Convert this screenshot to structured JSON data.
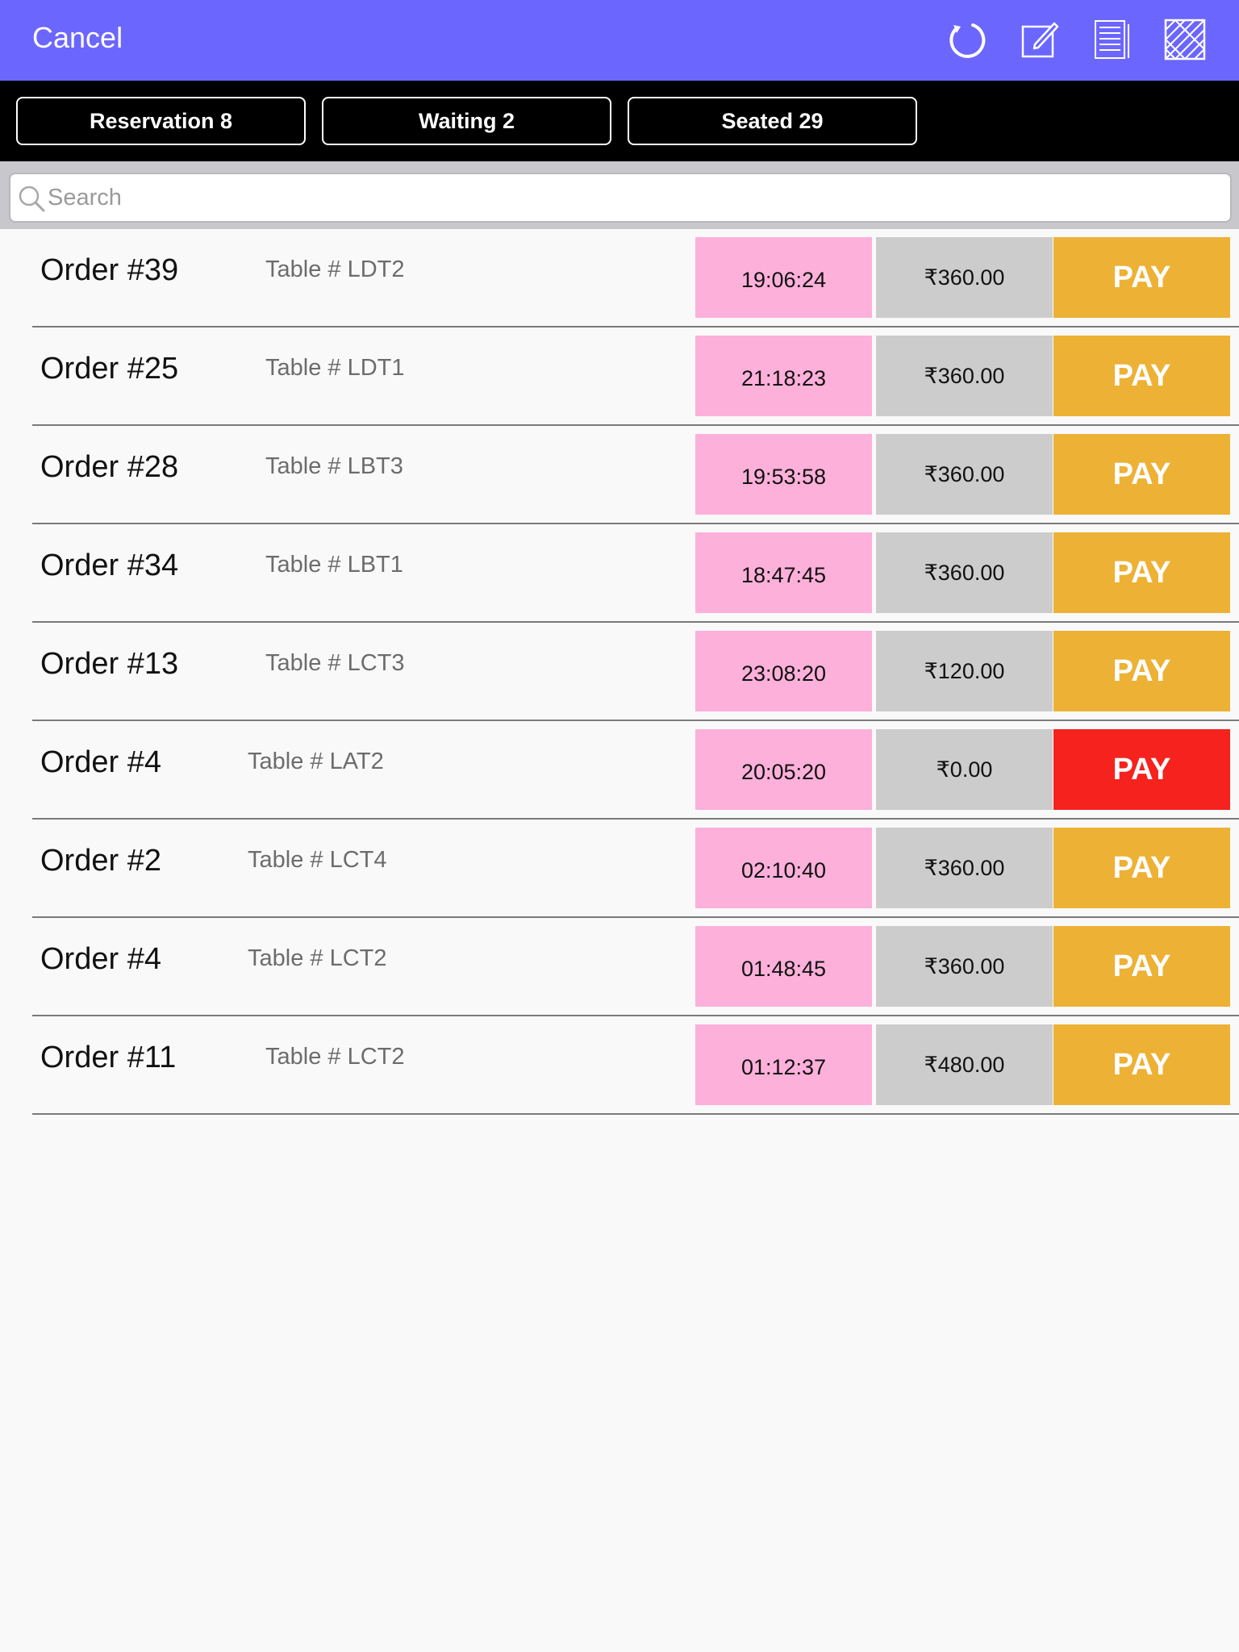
{
  "header": {
    "cancel_label": "Cancel",
    "background_color": "#6b66fd",
    "icons": [
      "refresh-icon",
      "edit-icon",
      "report-icon",
      "grid-pattern-icon"
    ]
  },
  "filters": [
    {
      "label": "Reservation 8"
    },
    {
      "label": "Waiting 2"
    },
    {
      "label": "Seated 29"
    }
  ],
  "search": {
    "placeholder": "Search",
    "value": ""
  },
  "colors": {
    "time_cell": "#fdb0da",
    "amount_cell": "#cccccc",
    "pay_default": "#edb135",
    "pay_alert": "#f6221e"
  },
  "orders": [
    {
      "order": "Order #39",
      "table": "Table # LDT2",
      "time": "19:06:24",
      "amount": "₹360.00",
      "pay_label": "PAY",
      "pay_color": "#edb135"
    },
    {
      "order": "Order #25",
      "table": "Table # LDT1",
      "time": "21:18:23",
      "amount": "₹360.00",
      "pay_label": "PAY",
      "pay_color": "#edb135"
    },
    {
      "order": "Order #28",
      "table": "Table # LBT3",
      "time": "19:53:58",
      "amount": "₹360.00",
      "pay_label": "PAY",
      "pay_color": "#edb135"
    },
    {
      "order": "Order #34",
      "table": "Table # LBT1",
      "time": "18:47:45",
      "amount": "₹360.00",
      "pay_label": "PAY",
      "pay_color": "#edb135"
    },
    {
      "order": "Order #13",
      "table": "Table # LCT3",
      "time": "23:08:20",
      "amount": "₹120.00",
      "pay_label": "PAY",
      "pay_color": "#edb135"
    },
    {
      "order": "Order #4",
      "table": "Table # LAT2",
      "time": "20:05:20",
      "amount": "₹0.00",
      "pay_label": "PAY",
      "pay_color": "#f6221e"
    },
    {
      "order": "Order #2",
      "table": "Table # LCT4",
      "time": "02:10:40",
      "amount": "₹360.00",
      "pay_label": "PAY",
      "pay_color": "#edb135"
    },
    {
      "order": "Order #4",
      "table": "Table # LCT2",
      "time": "01:48:45",
      "amount": "₹360.00",
      "pay_label": "PAY",
      "pay_color": "#edb135"
    },
    {
      "order": "Order #11",
      "table": "Table # LCT2",
      "time": "01:12:37",
      "amount": "₹480.00",
      "pay_label": "PAY",
      "pay_color": "#edb135"
    }
  ]
}
